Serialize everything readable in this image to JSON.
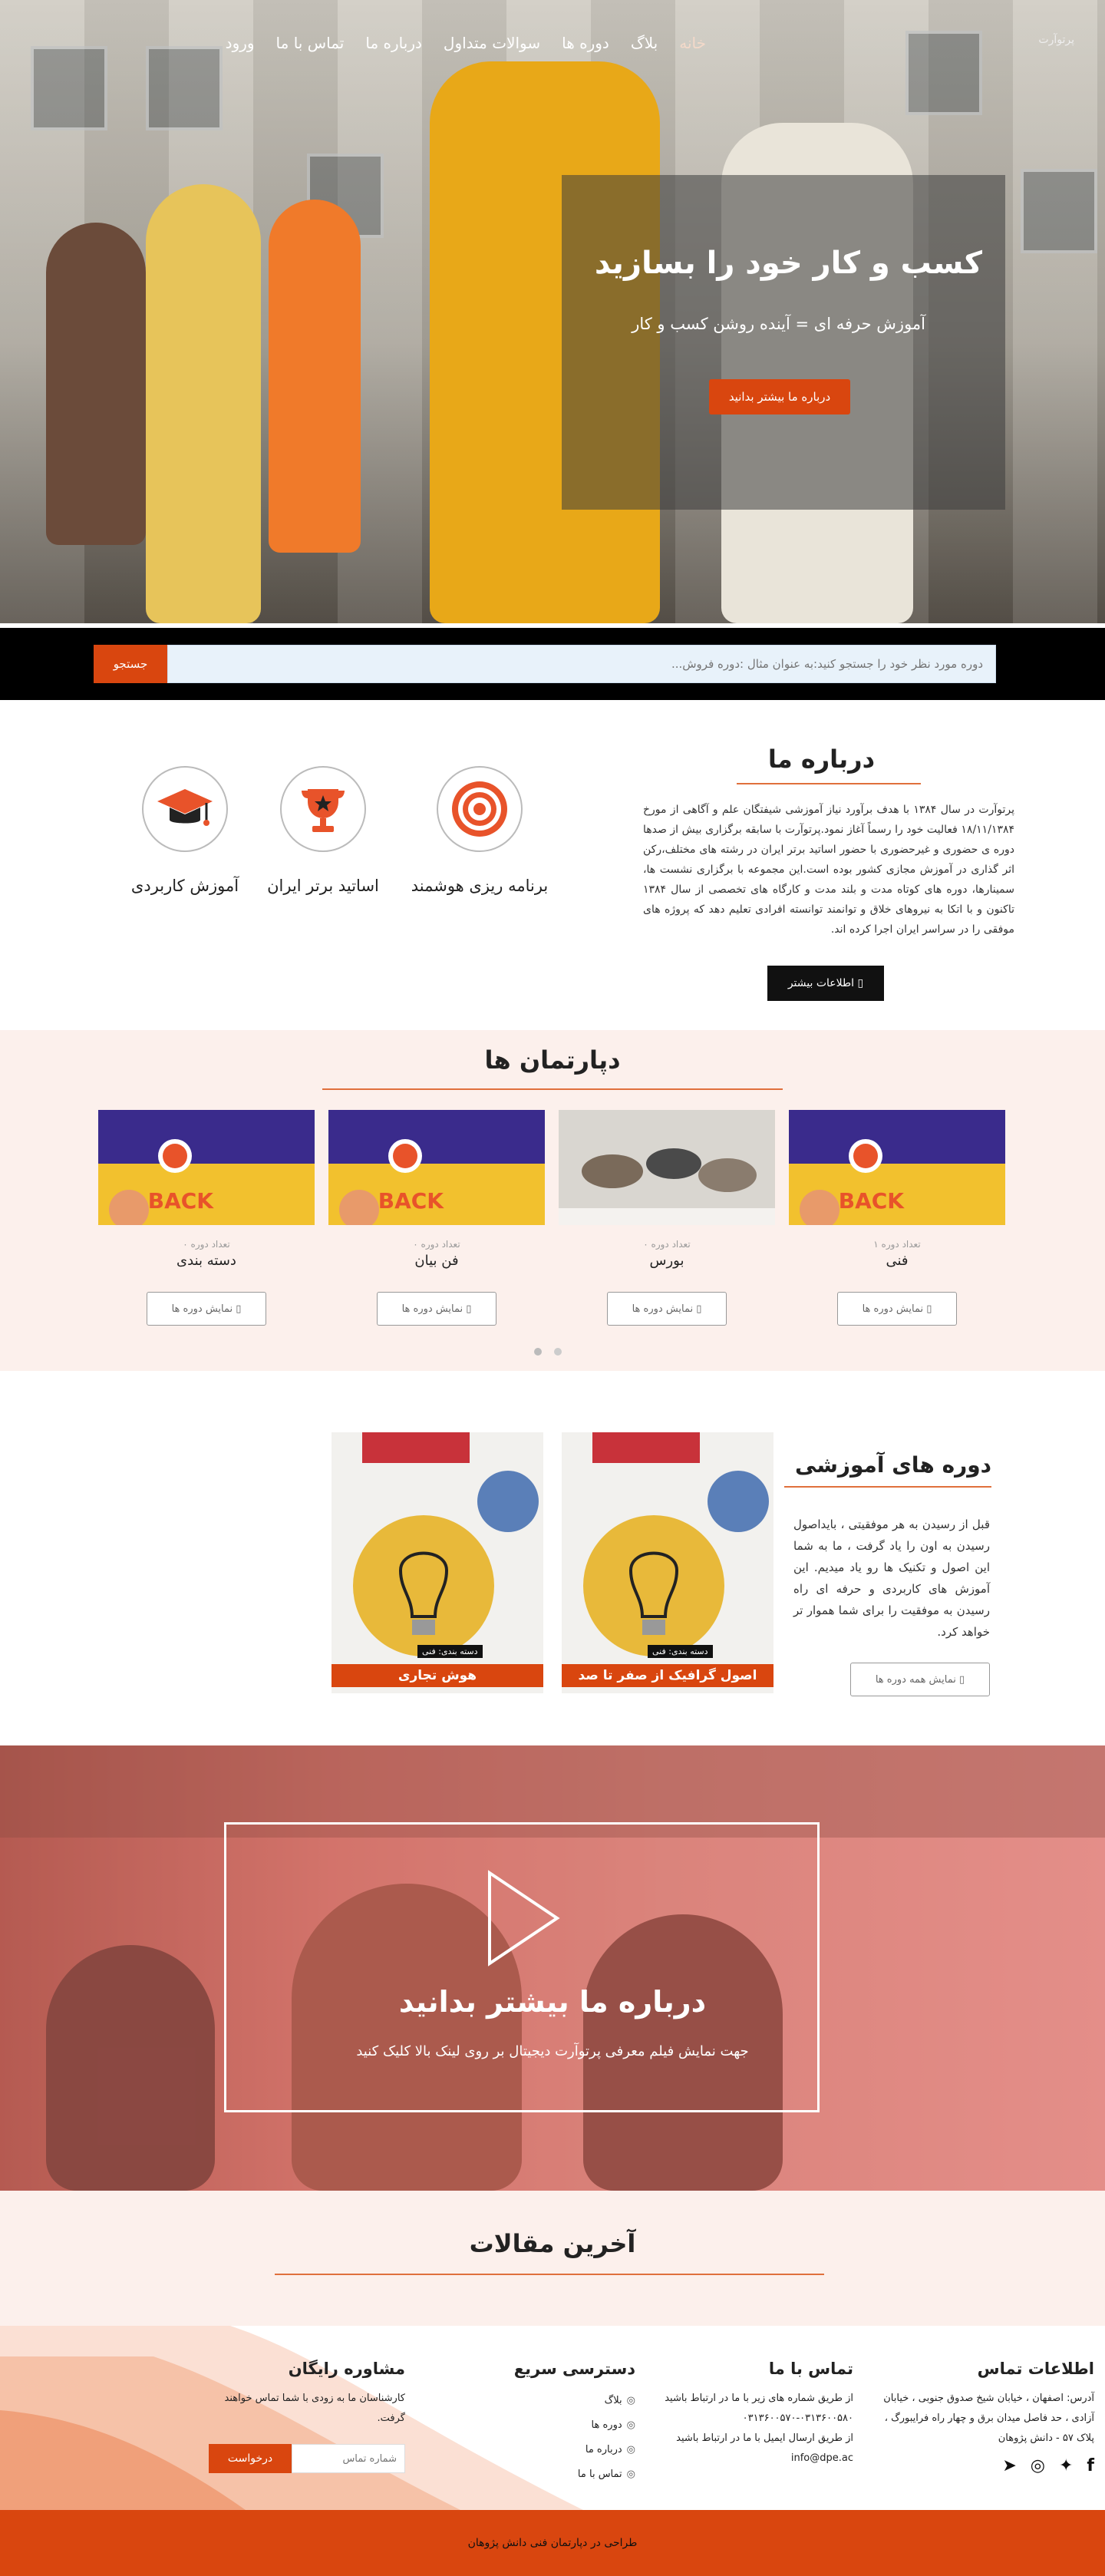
{
  "header": {
    "logo_alt": "پرتوآرت",
    "menu": [
      "خانه",
      "بلاگ",
      "دوره ها",
      "سوالات متداول",
      "درباره ما",
      "تماس با ما",
      "ورود"
    ]
  },
  "hero": {
    "title": "کسب و کار خود را بسازید",
    "subtitle": "آموزش حرفه ای = آینده روشن کسب و کار",
    "button": "درباره ما بیشتر بدانید"
  },
  "search": {
    "placeholder": "دوره مورد نظر خود را جستجو کنید:به عنوان مثال :دوره فروش...",
    "button": "جستجو"
  },
  "about": {
    "title": "درباره ما",
    "text": "پرتوآرت در سال ۱۳۸۴ با هدف برآورد نیاز آموزشی شیفتگان علم و آگاهی از مورخ ۱۸/۱۱/۱۳۸۴ فعالیت خود را رسماً آغاز نمود.پرتوآرت با سابقه برگزاری بیش از صدها دوره ی حضوری و غیرحضوری با حضور اساتید برتر ایران در رشته های مختلف،رکن اثر گذاری در آموزش مجازی کشور بوده است.این مجموعه با برگزاری نشست ها، سمینارها، دوره های کوتاه مدت و بلند مدت و کارگاه های تخصصی از سال ۱۳۸۴ تاکنون و با اتکا به نیروهای خلاق و توانمند توانسته افرادی تعلیم دهد که پروژه های موفقی را در سراسر ایران اجرا کرده اند.",
    "button": "اطلاعات بیشتر",
    "features": [
      {
        "label": "برنامه ریزی هوشمند",
        "icon": "target-icon"
      },
      {
        "label": "اساتید برتر ایران",
        "icon": "trophy-icon"
      },
      {
        "label": "آموزش کاربردی",
        "icon": "graduation-cap-icon"
      }
    ]
  },
  "departments": {
    "title": "دپارتمان ها",
    "items": [
      {
        "count": "تعداد دوره ۱",
        "name": "فنی",
        "button": "نمایش دوره ها"
      },
      {
        "count": "تعداد دوره ۰",
        "name": "بورس",
        "button": "نمایش دوره ها"
      },
      {
        "count": "تعداد دوره ۰",
        "name": "فن بیان",
        "button": "نمایش دوره ها"
      },
      {
        "count": "تعداد دوره ۰",
        "name": "دسته بندی",
        "button": "نمایش دوره ها"
      }
    ]
  },
  "courses": {
    "title": "دوره های آموزشی",
    "text": "قبل از رسیدن به هر موفقیتی ، بایداصول رسیدن به اون را یاد گرفت ، ما به شما این اصول و تکنیک ها رو یاد میدیم. این آموزش های کاربردی و حرفه ای راه رسیدن به موفقیت را برای شما هموار تر خواهد کرد.",
    "button": "نمایش همه دوره ها",
    "items": [
      {
        "title": "اصول گرافیک از صفر تا صد",
        "category": "دسته بندی: فنی"
      },
      {
        "title": "هوش تجاری",
        "category": "دسته بندی: فنی"
      }
    ]
  },
  "video": {
    "title": "درباره ما بیشتر بدانید",
    "subtitle": "جهت نمایش فیلم معرفی پرتوآرت دیجیتال بر روی لینک بالا کلیک کنید"
  },
  "articles": {
    "title": "آخرین مقالات"
  },
  "footer": {
    "contact_info": {
      "title": "اطلاعات تماس",
      "address": "آدرس: اصفهان ، خیابان شیخ صدوق جنوبی ، خیابان آزادی ، حد فاصل میدان برق و چهار راه فرایبورگ ، پلاک ۵۷ - دانش پژوهان"
    },
    "contact_us": {
      "title": "تماس با ما",
      "line1": "از طریق شماره های زیر با ما در ارتباط باشید",
      "phones": "۰۳۱۳۶۰۰۵۷۰-۰۳۱۳۶۰۰۵۸۰",
      "line2": "از طریق ارسال ایمیل با ما در ارتباط باشید",
      "email": "info@dpe.ac"
    },
    "quick_access": {
      "title": "دسترسی سریع",
      "links": [
        "بلاگ",
        "دوره ها",
        "درباره ما",
        "تماس با ما"
      ]
    },
    "consult": {
      "title": "مشاوره رایگان",
      "text": "کارشناسان ما به زودی با شما تماس خواهند گرفت.",
      "placeholder": "شماره تماس",
      "button": "درخواست"
    },
    "copyright": "طراحی در دپارتمان فنی دانش پژوهان"
  },
  "colors": {
    "accent": "#d9460f",
    "soft_bg": "#fcf0ec",
    "dark": "#111111"
  }
}
